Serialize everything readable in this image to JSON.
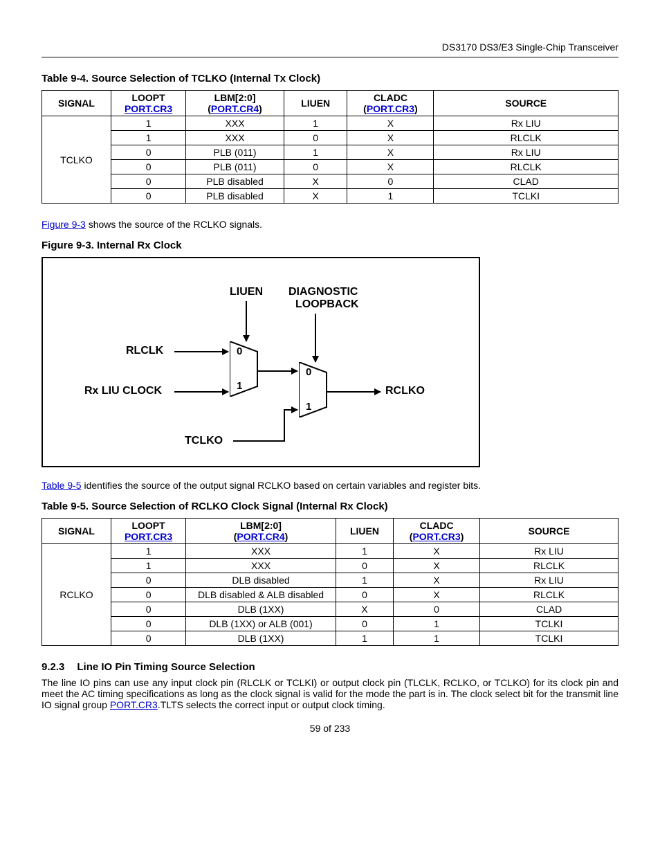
{
  "header": {
    "running": "DS3170 DS3/E3 Single-Chip Transceiver"
  },
  "footer": {
    "pagenum": "59 of 233"
  },
  "links": {
    "portcr3": "PORT.CR3",
    "portcr4": "PORT.CR4",
    "fig93": "Figure 9-3",
    "table95": "Table 9-5"
  },
  "para1_rest": " shows the source of the RCLKO signals.",
  "para2_rest": " identifies the source of the output signal RCLKO based on certain variables and register bits.",
  "section": {
    "num": "9.2.3",
    "title": "Line IO Pin Timing Source Selection",
    "body_before": "The line IO pins can use any input clock pin (RLCLK or TCLKI) or output clock pin (TLCLK, RCLKO, or TCLKO) for its clock pin and meet the AC timing specifications as long as the clock signal is valid for the mode the part is in. The clock select bit for the transmit line IO signal group ",
    "body_after": ".TLTS selects the correct input or output clock timing."
  },
  "table94": {
    "caption": "Table 9-4. Source Selection of TCLKO (Internal Tx Clock)",
    "headers": {
      "signal": "SIGNAL",
      "loopt": "LOOPT",
      "lbm": "LBM[2:0]",
      "liuen": "LIUEN",
      "cladc": "CLADC",
      "source": "SOURCE"
    },
    "signal_label": "TCLKO",
    "rows": [
      {
        "loopt": "1",
        "lbm": "XXX",
        "liuen": "1",
        "cladc": "X",
        "source": "Rx LIU"
      },
      {
        "loopt": "1",
        "lbm": "XXX",
        "liuen": "0",
        "cladc": "X",
        "source": "RLCLK"
      },
      {
        "loopt": "0",
        "lbm": "PLB (011)",
        "liuen": "1",
        "cladc": "X",
        "source": "Rx LIU"
      },
      {
        "loopt": "0",
        "lbm": "PLB (011)",
        "liuen": "0",
        "cladc": "X",
        "source": "RLCLK"
      },
      {
        "loopt": "0",
        "lbm": "PLB disabled",
        "liuen": "X",
        "cladc": "0",
        "source": "CLAD"
      },
      {
        "loopt": "0",
        "lbm": "PLB disabled",
        "liuen": "X",
        "cladc": "1",
        "source": "TCLKI"
      }
    ]
  },
  "fig93": {
    "caption": "Figure 9-3. Internal Rx Clock",
    "labels": {
      "liuen": "LIUEN",
      "diag1": "DIAGNOSTIC",
      "diag2": "LOOPBACK",
      "rlclk": "RLCLK",
      "rxliu": "Rx LIU CLOCK",
      "tclko": "TCLKO",
      "rclko": "RCLKO",
      "m0": "0",
      "m1": "1"
    }
  },
  "table95": {
    "caption": "Table 9-5. Source Selection of RCLKO Clock Signal (Internal Rx Clock)",
    "headers": {
      "signal": "SIGNAL",
      "loopt": "LOOPT",
      "lbm": "LBM[2:0]",
      "liuen": "LIUEN",
      "cladc": "CLADC",
      "source": "SOURCE"
    },
    "signal_label": "RCLKO",
    "rows": [
      {
        "loopt": "1",
        "lbm": "XXX",
        "liuen": "1",
        "cladc": "X",
        "source": "Rx LIU"
      },
      {
        "loopt": "1",
        "lbm": "XXX",
        "liuen": "0",
        "cladc": "X",
        "source": "RLCLK"
      },
      {
        "loopt": "0",
        "lbm": "DLB disabled",
        "liuen": "1",
        "cladc": "X",
        "source": "Rx LIU"
      },
      {
        "loopt": "0",
        "lbm": "DLB disabled & ALB disabled",
        "liuen": "0",
        "cladc": "X",
        "source": "RLCLK"
      },
      {
        "loopt": "0",
        "lbm": "DLB (1XX)",
        "liuen": "X",
        "cladc": "0",
        "source": "CLAD"
      },
      {
        "loopt": "0",
        "lbm": "DLB (1XX) or ALB (001)",
        "liuen": "0",
        "cladc": "1",
        "source": "TCLKI"
      },
      {
        "loopt": "0",
        "lbm": "DLB (1XX)",
        "liuen": "1",
        "cladc": "1",
        "source": "TCLKI"
      }
    ]
  }
}
